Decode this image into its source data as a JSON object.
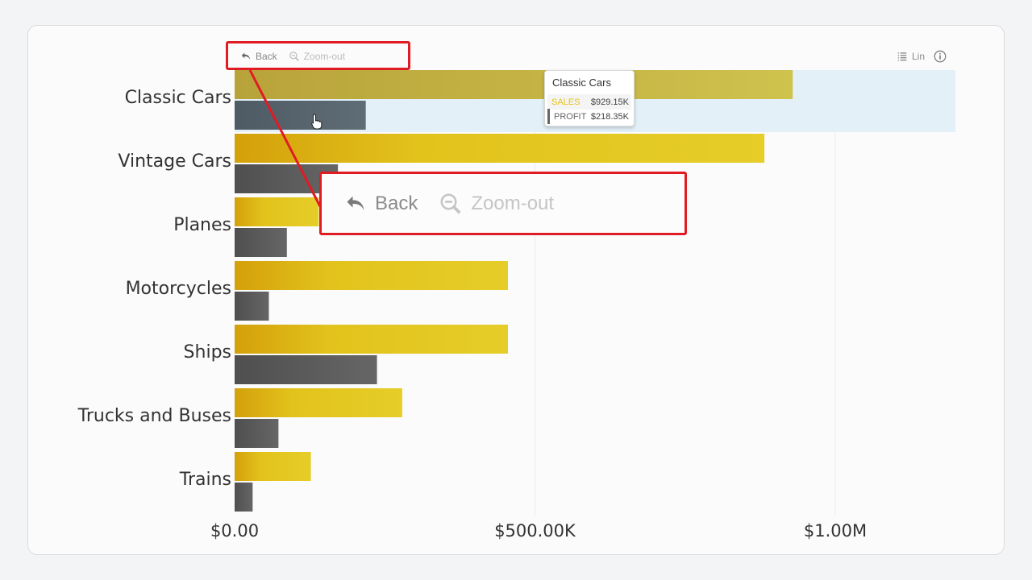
{
  "toolbar": {
    "back_label": "Back",
    "zoom_out_label": "Zoom-out",
    "scale_label": "Lin",
    "icons": {
      "back": "undo-arrow-icon",
      "zoom_out": "zoom-out-icon",
      "scale": "list-lines-icon",
      "info": "info-circle-icon"
    }
  },
  "callout": {
    "back_label": "Back",
    "zoom_out_label": "Zoom-out",
    "highlight_color": "#e01b24"
  },
  "tooltip": {
    "title": "Classic Cars",
    "rows": [
      {
        "label": "SALES",
        "value": "$929.15K",
        "color": "#e6c419"
      },
      {
        "label": "PROFIT",
        "value": "$218.35K",
        "color": "#666666"
      }
    ]
  },
  "chart_data": {
    "type": "bar",
    "orientation": "horizontal",
    "categories": [
      "Classic Cars",
      "Vintage Cars",
      "Planes",
      "Motorcycles",
      "Ships",
      "Trucks and Buses",
      "Trains"
    ],
    "series": [
      {
        "name": "SALES",
        "color": "#e2c31c",
        "values": [
          929150,
          882000,
          140000,
          455000,
          455000,
          279000,
          127000
        ]
      },
      {
        "name": "PROFIT",
        "color": "#5d5d5d",
        "values": [
          218350,
          172000,
          87000,
          57000,
          237000,
          73000,
          30000
        ]
      }
    ],
    "xlim": [
      0,
      1200000
    ],
    "xticks": [
      {
        "value": 0,
        "label": "$0.00"
      },
      {
        "value": 500000,
        "label": "$500.00K"
      },
      {
        "value": 1000000,
        "label": "$1.00M"
      }
    ],
    "highlighted_category": "Classic Cars",
    "highlight_color": "#e3f0f8",
    "legend": "none",
    "grid": true
  }
}
